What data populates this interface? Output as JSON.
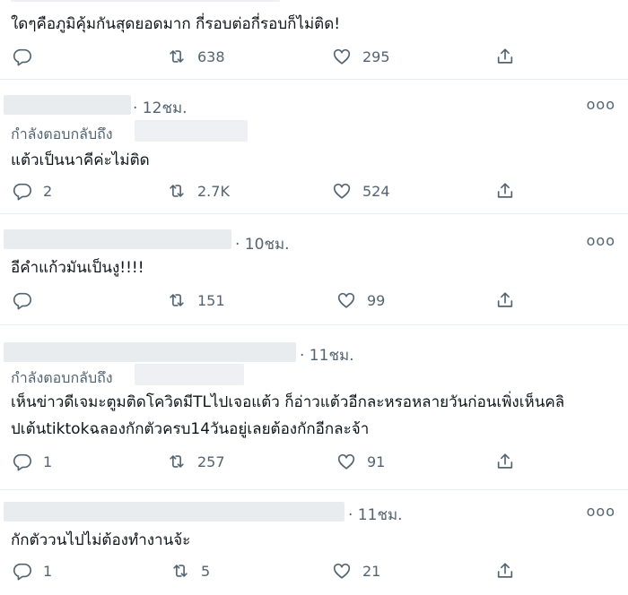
{
  "top_tweet": {
    "text": "ใดๆคือภูมิคุ้มกันสุดยอดมาก กี่รอบต่อกี่รอบก็ไม่ติด!",
    "replies": "",
    "retweets": "638",
    "likes": "295"
  },
  "replies": [
    {
      "time": "· 12ชม.",
      "reply_to_label": "กำลังตอบกลับถึง",
      "text": "แต้วเป็นนาคีค่ะไม่ติด",
      "replies": "2",
      "retweets": "2.7K",
      "likes": "524"
    },
    {
      "time": "· 10ชม.",
      "text": "อีคำแก้วมันเป็นงู!!!!",
      "replies": "",
      "retweets": "151",
      "likes": "99"
    },
    {
      "time": "· 11ชม.",
      "reply_to_label": "กำลังตอบกลับถึง",
      "text_line1": "เห็นข่าวดีเจมะตูมติดโควิดมีTLไปเจอแต้ว ก็อ่าวแต้วอีกละหรอหลายวันก่อนเพิ่งเห็นคลิ",
      "text_line2": "ปเต้นtiktokฉลองกักตัวครบ14วันอยู่เลยต้องกักอีกละจ้า",
      "replies": "1",
      "retweets": "257",
      "likes": "91"
    },
    {
      "time": "· 11ชม.",
      "text": "กักตัววนไปไม่ต้องทำงานจ้ะ",
      "replies": "1",
      "retweets": "5",
      "likes": "21"
    }
  ],
  "icons": {
    "reply": "reply-icon",
    "retweet": "retweet-icon",
    "like": "like-icon",
    "share": "share-icon",
    "more": "more-icon"
  },
  "more_glyph": "ooo"
}
